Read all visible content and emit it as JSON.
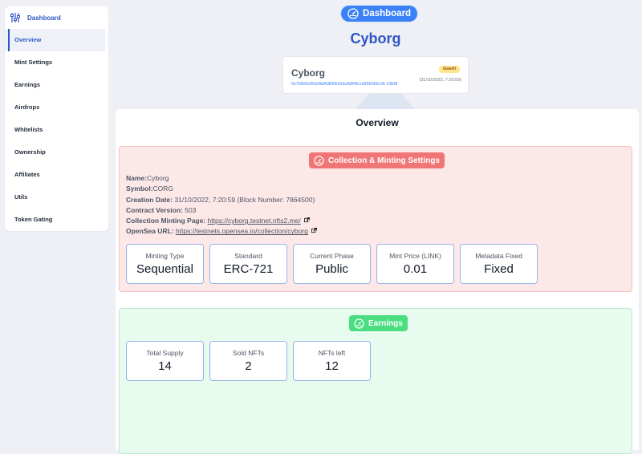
{
  "sidebar": {
    "header": {
      "label": "Dashboard",
      "icon": "sliders-icon"
    },
    "items": [
      {
        "label": "Overview",
        "active": true
      },
      {
        "label": "Mint Settings"
      },
      {
        "label": "Earnings"
      },
      {
        "label": "Airdrops"
      },
      {
        "label": "Whitelists"
      },
      {
        "label": "Ownership"
      },
      {
        "label": "Affiliates"
      },
      {
        "label": "Utils"
      },
      {
        "label": "Token Gating"
      }
    ]
  },
  "header": {
    "dashboard_pill": "Dashboard",
    "dashboard_icon": "gauge-icon",
    "page_title": "Cyborg"
  },
  "collection_card": {
    "name": "Cyborg",
    "address": "0x7b566eB0d4dA0B5B1b6eA8f4E1d95635Ecfb C8D8",
    "network": "Goerli",
    "timestamp": "(31/10/2022, 7:20:59)"
  },
  "overview": {
    "title": "Overview",
    "collection_section": {
      "title": "Collection & Minting Settings",
      "icon": "gauge-icon",
      "name_key": "Name:",
      "name_value": "Cyborg",
      "symbol_key": "Symbol:",
      "symbol_value": "CORG",
      "creation_key": "Creation Date:",
      "creation_value": " 31/10/2022, 7:20:59 (Block Number: 7864500)",
      "contract_key": "Contract Version:",
      "contract_value": " 503",
      "minting_key": "Collection Minting Page:",
      "minting_url": "https://cyborg.testnet.nfts2.me/",
      "opensea_key": "OpenSea URL:",
      "opensea_url": "https://testnets.opensea.io/collection/cyborg",
      "stats": [
        {
          "label": "Minting Type",
          "value": "Sequential"
        },
        {
          "label": "Standard",
          "value": "ERC-721"
        },
        {
          "label": "Current Phase",
          "value": "Public"
        },
        {
          "label": "Mint Price (LINK)",
          "value": "0.01"
        },
        {
          "label": "Metadata Fixed",
          "value": "Fixed"
        }
      ]
    },
    "earnings_section": {
      "title": "Earnings",
      "icon": "gauge-icon",
      "stats": [
        {
          "label": "Total Supply",
          "value": "14"
        },
        {
          "label": "Sold NFTs",
          "value": "2"
        },
        {
          "label": "NFTs left",
          "value": "12"
        }
      ]
    }
  },
  "colors": {
    "accent": "#2f55c8",
    "pill_blue": "#3b82f6",
    "red_section": "#fde8e8",
    "red_pill": "#f07575",
    "green_section": "#e7fbee",
    "green_pill": "#4ade80"
  }
}
